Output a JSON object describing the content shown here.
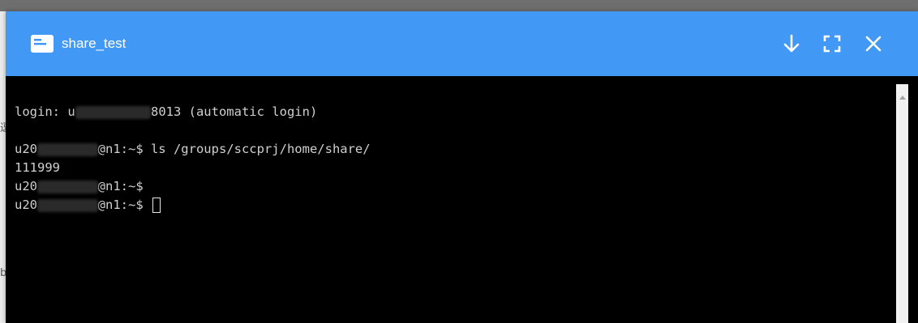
{
  "window": {
    "title": "share_test",
    "accent_color": "#4299f5",
    "icons": {
      "title": "terminal-window-icon",
      "download": "arrow-down-icon",
      "fullscreen": "fullscreen-icon",
      "close": "close-icon"
    }
  },
  "background": {
    "left_glyph_1": "逗",
    "left_glyph_2": "b"
  },
  "terminal": {
    "line1": {
      "prefix": "login: u",
      "redacted": "2010053013",
      "suffix": "8013 (automatic login)"
    },
    "line2": {
      "prefix": "u20",
      "redacted": "10053015",
      "suffix": "@n1:~$ ls /groups/sccprj/home/share/"
    },
    "line3": {
      "text": "111999"
    },
    "line4": {
      "prefix": "u20",
      "redacted": "10053015",
      "suffix": "@n1:~$"
    },
    "line5": {
      "prefix": "u20",
      "redacted": "10053015",
      "suffix": "@n1:~$ "
    }
  }
}
